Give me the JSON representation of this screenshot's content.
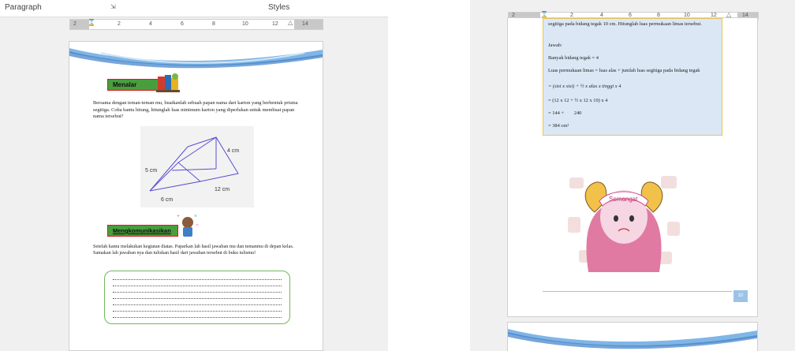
{
  "left_window": {
    "ribbon": {
      "paragraph_label": "Paragraph",
      "launcher_icon": "dialog-launcher-icon",
      "styles_label": "Styles"
    },
    "ruler_numbers": [
      "2",
      "2",
      "4",
      "6",
      "8",
      "10",
      "12",
      "14"
    ],
    "page": {
      "menalar_label": "Menalar",
      "paragraph1": "Bersama dengan teman-teman mu, buatkanlah sebuah papan nama dari karton yang berbentuk prisma segitiga. Coba bantu hitung, hitunglah luas minimum karton yang diperlukan untuk membuat papan nama tersebut?",
      "diagram": {
        "label_height": "4 cm",
        "label_side": "5 cm",
        "label_base": "6 cm",
        "label_length": "12 cm"
      },
      "mengkomunikasikan_label": "Mengkomunikasikan",
      "paragraph2": "Setelah kamu melakukan kegiatan diatas. Paparkan lah hasil jawaban mu dan temanmu di depan kelas. Samakan lah jawaban nya dan tuliskan hasil dari jawaban tersebut di buku tulismu!"
    }
  },
  "right_window": {
    "ruler_numbers": [
      "2",
      "2",
      "4",
      "6",
      "8",
      "10",
      "12",
      "14"
    ],
    "page": {
      "question_cut": "segitiga pada bidang tegak 10 cm. Hitunglah luas permukaan limas tersebut.",
      "jawab": "Jawab:",
      "line1": "Banyak bidang tegak = 4",
      "line2": "Luas permukaan limas = luas alas + jumlah luas segitiga pada bidang tegak",
      "line3": "= (sisi x sisi) + ½ x alas x tinggi x 4",
      "line4": "= (12 x 12 + ½ x 12 x 10) x 4",
      "line5": "= 144 +        240",
      "line6": "= 384 cm²",
      "sticker_text": "Semangat",
      "page_number": "10"
    }
  },
  "colors": {
    "label_green": "#4a9d3d",
    "label_border": "#cc2222",
    "answer_bg": "#dbe7f5",
    "answer_border": "#e8c558",
    "box_border": "#6fb85a"
  }
}
